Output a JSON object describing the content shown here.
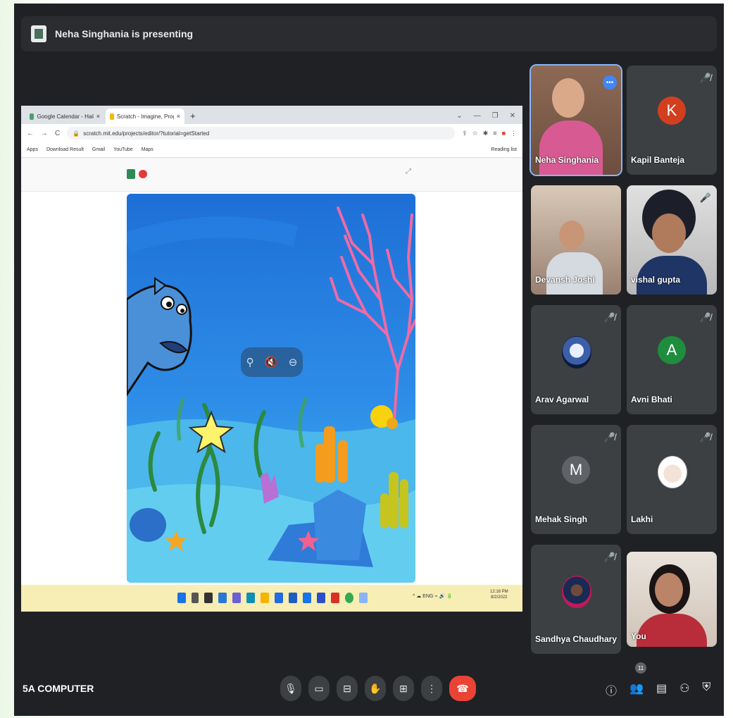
{
  "presenting": {
    "text": "Neha Singhania is presenting"
  },
  "shared_screen": {
    "tabs": [
      {
        "label": "Google Calendar - Hailey Jamu",
        "active": false
      },
      {
        "label": "Scratch - Imagine, Program, Share",
        "active": true
      }
    ],
    "url": "scratch.mit.edu/projects/editor/?tutorial=getStarted",
    "bookmarks": [
      "Apps",
      "Download Result",
      "Gmail",
      "YouTube",
      "Maps"
    ],
    "reading_list": "Reading list",
    "clock": {
      "time": "12:18 PM",
      "date": "8/2/2022"
    }
  },
  "participants": [
    {
      "name": "Neha Singhania",
      "type": "video",
      "speaking": true
    },
    {
      "name": "Kapil Banteja",
      "type": "letter",
      "letter": "K",
      "color": "#d23f1f",
      "muted": true
    },
    {
      "name": "Devansh Joshi",
      "type": "video"
    },
    {
      "name": "vishal gupta",
      "type": "video",
      "muted": true
    },
    {
      "name": "Arav Agarwal",
      "type": "image",
      "muted": true
    },
    {
      "name": "Avni Bhati",
      "type": "letter",
      "letter": "A",
      "color": "#1e8e3e",
      "muted": true
    },
    {
      "name": "Mehak Singh",
      "type": "letter",
      "letter": "M",
      "color": "#5f6368",
      "muted": true
    },
    {
      "name": "Lakhi",
      "type": "image",
      "muted": true
    },
    {
      "name": "Sandhya Chaudhary",
      "type": "image",
      "muted": true
    },
    {
      "name": "You",
      "type": "video"
    }
  ],
  "meeting": {
    "name": "5A COMPUTER",
    "participant_count": "11"
  },
  "colors": {
    "bg": "#202124",
    "tile": "#3c4043",
    "end_call": "#ea4335",
    "accent": "#8ab4f8"
  }
}
